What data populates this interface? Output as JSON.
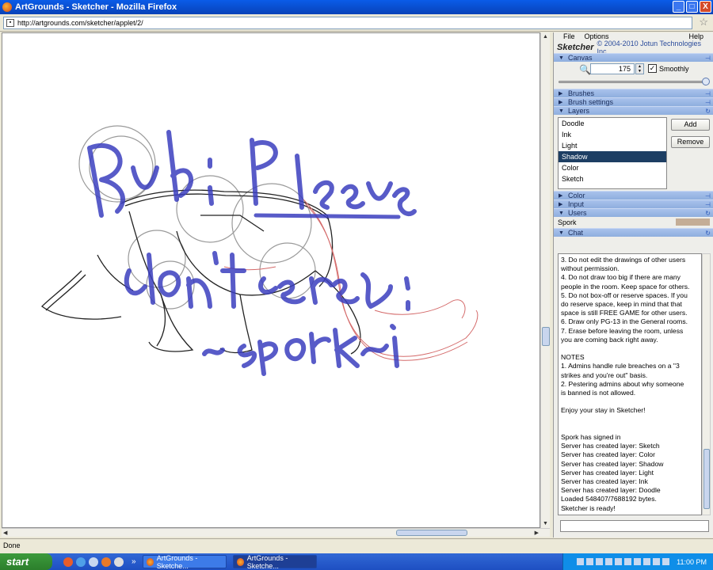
{
  "window": {
    "title": "ArtGrounds - Sketcher - Mozilla Firefox",
    "min": "_",
    "max": "□",
    "close": "X"
  },
  "address": {
    "url": "http://artgrounds.com/sketcher/applet/2/"
  },
  "panel": {
    "menu": {
      "file": "File",
      "options": "Options",
      "help": "Help"
    },
    "brand": {
      "logo": "Sketcher",
      "copyright": "© 2004-2010 Jotun Technologies Inc."
    },
    "sections": {
      "canvas": "Canvas",
      "brushes": "Brushes",
      "brush_settings": "Brush settings",
      "layers": "Layers",
      "color": "Color",
      "input": "Input",
      "users": "Users",
      "chat": "Chat"
    },
    "zoom_value": "175",
    "smoothly_label": "Smoothly",
    "layers": [
      "Doodle",
      "Ink",
      "Light",
      "Shadow",
      "Color",
      "Sketch"
    ],
    "add_label": "Add",
    "remove_label": "Remove",
    "user": "Spork",
    "chat_lines": [
      "3. Do not edit the drawings of other users",
      "without permission.",
      "4. Do not draw too big if there are many",
      "people in the room. Keep space for others.",
      "5. Do not box-off or reserve spaces. If you",
      "do reserve space, keep in mind that that",
      "space is still FREE GAME for other users.",
      "6. Draw only PG-13 in the General rooms.",
      "7. Erase before leaving the room, unless",
      "you are coming back right away.",
      "",
      "NOTES",
      "1. Admins handle rule breaches on a \"3",
      "strikes and you're out\" basis.",
      "2. Pestering admins about why someone",
      "is banned is not allowed.",
      "",
      "Enjoy your stay in Sketcher!",
      "",
      "",
      "Spork has signed in",
      "Server has created layer: Sketch",
      "Server has created layer: Color",
      "Server has created layer: Shadow",
      "Server has created layer: Light",
      "Server has created layer: Ink",
      "Server has created layer: Doodle",
      "Loaded 548407/7688192 bytes.",
      "Sketcher is ready!"
    ]
  },
  "status": "Done",
  "taskbar": {
    "start": "start",
    "tasks": [
      "ArtGrounds - Sketche...",
      "ArtGrounds - Sketche..."
    ],
    "chevron": "»",
    "clock": "11:00 PM"
  },
  "colors": {
    "doodle_blue": "#3b3fbf",
    "sketch_red": "#d46a6a",
    "ink": "#222222",
    "selected_layer": "#1d3e63"
  }
}
